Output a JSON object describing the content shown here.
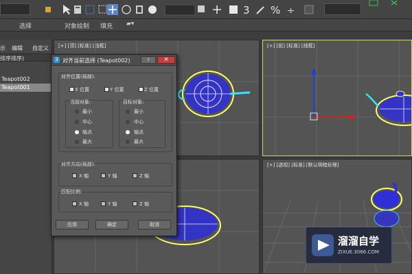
{
  "ribbon": {
    "items": [
      "选择",
      "对象绘制",
      "填充"
    ]
  },
  "left_panel": {
    "menu": [
      "示",
      "编辑",
      "自定义"
    ],
    "sort_header": "排序排序)",
    "items": [
      "Teapot002",
      "Teapot001"
    ],
    "selected_index": 1
  },
  "viewports": {
    "top_left": {
      "label": "[+] [顶] [标准] [线框]"
    },
    "top_right": {
      "label": "[+] [前] [标准] [线框]"
    },
    "bottom_right": {
      "label": "[+] [透视] [标准] [默认明暗处理]"
    }
  },
  "dialog": {
    "title": "对齐当前选择 (Teapot002)",
    "help_label": "?",
    "close_label": "×",
    "align_position_label": "对齐位置(局部):",
    "axes": [
      {
        "label": "X 位置",
        "checked": true
      },
      {
        "label": "Y 位置",
        "checked": true
      },
      {
        "label": "Z 位置",
        "checked": true
      }
    ],
    "current_object": {
      "title": "当前对象:",
      "options": [
        "最小",
        "中心",
        "轴点",
        "最大"
      ],
      "selected": 2
    },
    "target_object": {
      "title": "目标对象:",
      "options": [
        "最小",
        "中心",
        "轴点",
        "最大"
      ],
      "selected": 2
    },
    "orientation": {
      "label": "对齐方向(局部):",
      "axes": [
        {
          "label": "X 轴",
          "checked": false
        },
        {
          "label": "Y 轴",
          "checked": false
        },
        {
          "label": "Z 轴",
          "checked": false
        }
      ]
    },
    "scale": {
      "label": "匹配比例:",
      "axes": [
        {
          "label": "X 轴",
          "checked": false
        },
        {
          "label": "Y 轴",
          "checked": false
        },
        {
          "label": "Z 轴",
          "checked": false
        }
      ]
    },
    "buttons": {
      "apply": "应用",
      "ok": "确定",
      "cancel": "取消"
    }
  },
  "watermark": {
    "title": "溜溜自学",
    "url": "ZIXUE.3066.COM"
  },
  "colors": {
    "accent_selection": "#ffff66",
    "wireframe": "#2f2fd8",
    "highlight_cyan": "#33e6ff"
  }
}
